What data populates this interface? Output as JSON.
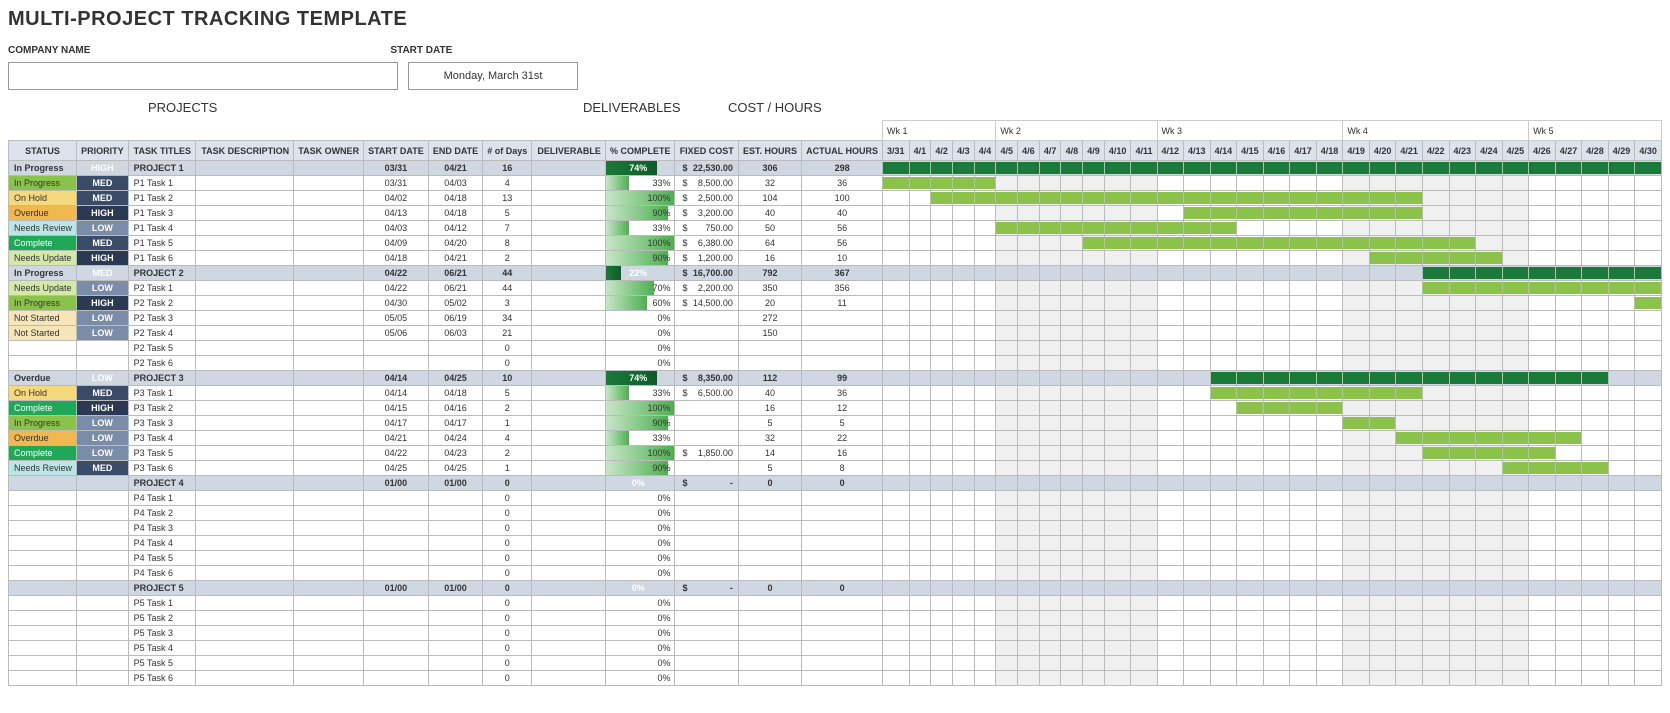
{
  "title": "MULTI-PROJECT TRACKING TEMPLATE",
  "labels": {
    "company": "COMPANY NAME",
    "startdate": "START DATE",
    "projects": "PROJECTS",
    "deliverables": "DELIVERABLES",
    "costhours": "COST / HOURS"
  },
  "start_date": "Monday, March 31st",
  "weeks": [
    "Wk 1",
    "Wk 2",
    "Wk 3",
    "Wk 4",
    "Wk 5"
  ],
  "days": [
    "3/31",
    "4/1",
    "4/2",
    "4/3",
    "4/4",
    "4/5",
    "4/6",
    "4/7",
    "4/8",
    "4/9",
    "4/10",
    "4/11",
    "4/12",
    "4/13",
    "4/14",
    "4/15",
    "4/16",
    "4/17",
    "4/18",
    "4/19",
    "4/20",
    "4/21",
    "4/22",
    "4/23",
    "4/24",
    "4/25",
    "4/26",
    "4/27",
    "4/28",
    "4/29",
    "4/30"
  ],
  "headers": {
    "status": "STATUS",
    "priority": "PRIORITY",
    "task": "TASK TITLES",
    "desc": "TASK DESCRIPTION",
    "owner": "TASK OWNER",
    "start": "START DATE",
    "end": "END DATE",
    "days": "# of Days",
    "deliv": "DELIVERABLE",
    "pct": "% COMPLETE",
    "cost": "FIXED COST",
    "est": "EST. HOURS",
    "act": "ACTUAL HOURS"
  },
  "rows": [
    {
      "type": "proj",
      "status": "In Progress",
      "scl": "s-inprogress",
      "pri": "HIGH",
      "pcl": "p-high",
      "title": "PROJECT 1",
      "start": "03/31",
      "end": "04/21",
      "days": "16",
      "pct": 74,
      "cost": "22,530.00",
      "est": "306",
      "act": "298",
      "g": [
        0,
        31,
        "d"
      ]
    },
    {
      "status": "In Progress",
      "scl": "s-inprogress",
      "pri": "MED",
      "pcl": "p-med",
      "title": "P1 Task 1",
      "start": "03/31",
      "end": "04/03",
      "days": "4",
      "pct": 33,
      "cost": "8,500.00",
      "est": "32",
      "act": "36",
      "g": [
        0,
        5
      ]
    },
    {
      "status": "On Hold",
      "scl": "s-onhold",
      "pri": "MED",
      "pcl": "p-med",
      "title": "P1 Task 2",
      "start": "04/02",
      "end": "04/18",
      "days": "13",
      "pct": 100,
      "cost": "2,500.00",
      "est": "104",
      "act": "100",
      "g": [
        2,
        22
      ]
    },
    {
      "status": "Overdue",
      "scl": "s-overdue",
      "pri": "HIGH",
      "pcl": "p-high",
      "title": "P1 Task 3",
      "start": "04/13",
      "end": "04/18",
      "days": "5",
      "pct": 90,
      "cost": "3,200.00",
      "est": "40",
      "act": "40",
      "g": [
        13,
        22
      ]
    },
    {
      "status": "Needs Review",
      "scl": "s-needsreview",
      "pri": "LOW",
      "pcl": "p-low",
      "title": "P1 Task 4",
      "start": "04/03",
      "end": "04/12",
      "days": "7",
      "pct": 33,
      "cost": "750.00",
      "est": "50",
      "act": "56",
      "g": [
        5,
        15
      ]
    },
    {
      "status": "Complete",
      "scl": "s-complete",
      "pri": "MED",
      "pcl": "p-med",
      "title": "P1 Task 5",
      "start": "04/09",
      "end": "04/20",
      "days": "8",
      "pct": 100,
      "cost": "6,380.00",
      "est": "64",
      "act": "56",
      "g": [
        9,
        24
      ]
    },
    {
      "status": "Needs Update",
      "scl": "s-needsupdate",
      "pri": "HIGH",
      "pcl": "p-high",
      "title": "P1 Task 6",
      "start": "04/18",
      "end": "04/21",
      "days": "2",
      "pct": 90,
      "cost": "1,200.00",
      "est": "16",
      "act": "10",
      "g": [
        20,
        25
      ]
    },
    {
      "type": "proj",
      "status": "In Progress",
      "scl": "s-inprogress",
      "pri": "MED",
      "pcl": "p-med",
      "title": "PROJECT 2",
      "start": "04/22",
      "end": "06/21",
      "days": "44",
      "pct": 22,
      "cost": "16,700.00",
      "est": "792",
      "act": "367",
      "g": [
        22,
        31,
        "d"
      ]
    },
    {
      "status": "Needs Update",
      "scl": "s-needsupdate",
      "pri": "LOW",
      "pcl": "p-low",
      "title": "P2 Task 1",
      "start": "04/22",
      "end": "06/21",
      "days": "44",
      "pct": 70,
      "cost": "2,200.00",
      "est": "350",
      "act": "356",
      "g": [
        22,
        31
      ]
    },
    {
      "status": "In Progress",
      "scl": "s-inprogress",
      "pri": "HIGH",
      "pcl": "p-high",
      "title": "P2 Task 2",
      "start": "04/30",
      "end": "05/02",
      "days": "3",
      "pct": 60,
      "cost": "14,500.00",
      "est": "20",
      "act": "11",
      "g": [
        30,
        31
      ]
    },
    {
      "status": "Not Started",
      "scl": "s-notstarted",
      "pri": "LOW",
      "pcl": "p-low",
      "title": "P2 Task 3",
      "start": "05/05",
      "end": "06/19",
      "days": "34",
      "pct": 0,
      "est": "272"
    },
    {
      "status": "Not Started",
      "scl": "s-notstarted",
      "pri": "LOW",
      "pcl": "p-low",
      "title": "P2 Task 4",
      "start": "05/06",
      "end": "06/03",
      "days": "21",
      "pct": 0,
      "est": "150"
    },
    {
      "title": "P2 Task 5",
      "days": "0",
      "pct": 0
    },
    {
      "title": "P2 Task 6",
      "days": "0",
      "pct": 0
    },
    {
      "type": "proj",
      "status": "Overdue",
      "scl": "s-overdue",
      "pri": "LOW",
      "pcl": "p-low",
      "title": "PROJECT 3",
      "start": "04/14",
      "end": "04/25",
      "days": "10",
      "pct": 74,
      "cost": "8,350.00",
      "est": "112",
      "act": "99",
      "g": [
        14,
        29,
        "d"
      ]
    },
    {
      "status": "On Hold",
      "scl": "s-onhold",
      "pri": "MED",
      "pcl": "p-med",
      "title": "P3 Task 1",
      "start": "04/14",
      "end": "04/18",
      "days": "5",
      "pct": 33,
      "cost": "6,500.00",
      "est": "40",
      "act": "36",
      "g": [
        14,
        22
      ]
    },
    {
      "status": "Complete",
      "scl": "s-complete",
      "pri": "HIGH",
      "pcl": "p-high",
      "title": "P3 Task 2",
      "start": "04/15",
      "end": "04/16",
      "days": "2",
      "pct": 100,
      "est": "16",
      "act": "12",
      "g": [
        15,
        19
      ]
    },
    {
      "status": "In Progress",
      "scl": "s-inprogress",
      "pri": "LOW",
      "pcl": "p-low",
      "title": "P3 Task 3",
      "start": "04/17",
      "end": "04/17",
      "days": "1",
      "pct": 90,
      "est": "5",
      "act": "5",
      "g": [
        19,
        21
      ]
    },
    {
      "status": "Overdue",
      "scl": "s-overdue",
      "pri": "LOW",
      "pcl": "p-low",
      "title": "P3 Task 4",
      "start": "04/21",
      "end": "04/24",
      "days": "4",
      "pct": 33,
      "est": "32",
      "act": "22",
      "g": [
        21,
        28
      ]
    },
    {
      "status": "Complete",
      "scl": "s-complete",
      "pri": "LOW",
      "pcl": "p-low",
      "title": "P3 Task 5",
      "start": "04/22",
      "end": "04/23",
      "days": "2",
      "pct": 100,
      "cost": "1,850.00",
      "est": "14",
      "act": "16",
      "g": [
        22,
        27
      ]
    },
    {
      "status": "Needs Review",
      "scl": "s-needsreview",
      "pri": "MED",
      "pcl": "p-med",
      "title": "P3 Task 6",
      "start": "04/25",
      "end": "04/25",
      "days": "1",
      "pct": 90,
      "est": "5",
      "act": "8",
      "g": [
        25,
        29
      ]
    },
    {
      "type": "proj",
      "title": "PROJECT 4",
      "start": "01/00",
      "end": "01/00",
      "days": "0",
      "pct": 0,
      "cost": "-",
      "est": "0",
      "act": "0"
    },
    {
      "title": "P4 Task 1",
      "days": "0",
      "pct": 0
    },
    {
      "title": "P4 Task 2",
      "days": "0",
      "pct": 0
    },
    {
      "title": "P4 Task 3",
      "days": "0",
      "pct": 0
    },
    {
      "title": "P4 Task 4",
      "days": "0",
      "pct": 0
    },
    {
      "title": "P4 Task 5",
      "days": "0",
      "pct": 0
    },
    {
      "title": "P4 Task 6",
      "days": "0",
      "pct": 0
    },
    {
      "type": "proj",
      "title": "PROJECT 5",
      "start": "01/00",
      "end": "01/00",
      "days": "0",
      "pct": 0,
      "cost": "-",
      "est": "0",
      "act": "0"
    },
    {
      "title": "P5 Task 1",
      "days": "0",
      "pct": 0
    },
    {
      "title": "P5 Task 2",
      "days": "0",
      "pct": 0
    },
    {
      "title": "P5 Task 3",
      "days": "0",
      "pct": 0
    },
    {
      "title": "P5 Task 4",
      "days": "0",
      "pct": 0
    },
    {
      "title": "P5 Task 5",
      "days": "0",
      "pct": 0
    },
    {
      "title": "P5 Task 6",
      "days": "0",
      "pct": 0
    }
  ]
}
